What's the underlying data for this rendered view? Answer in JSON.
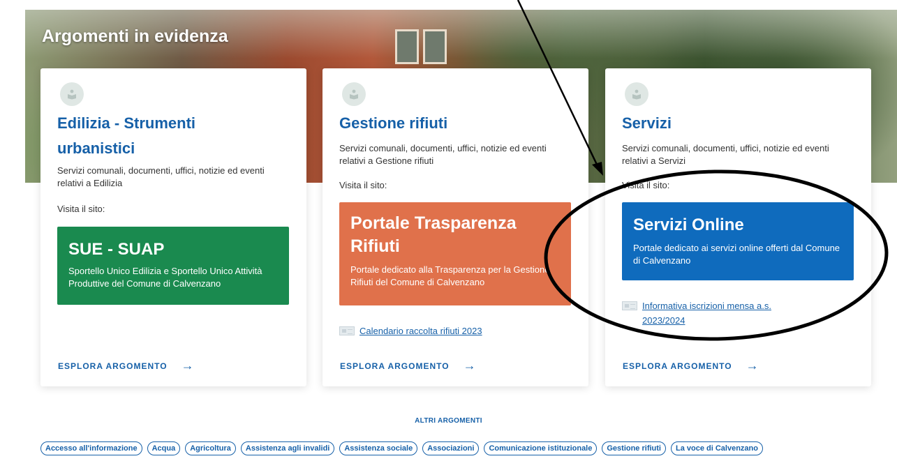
{
  "section": {
    "title": "Argomenti in evidenza"
  },
  "cards": [
    {
      "title_line1": "Edilizia - Strumenti",
      "title_line2": "urbanistici",
      "description": "Servizi comunali, documenti, uffici, notizie ed eventi relativi a Edilizia",
      "visit_label": "Visita il sito:",
      "promo": {
        "title": "SUE - SUAP",
        "text": "Sportello Unico Edilizia e Sportello Unico Attività Produttive del Comune di Calvenzano",
        "color": "#1a8a4f"
      },
      "explore_label": "ESPLORA ARGOMENTO",
      "explore_arrow": "→"
    },
    {
      "title_line1": "Gestione rifiuti",
      "description": "Servizi comunali, documenti, uffici, notizie ed eventi relativi a Gestione rifiuti",
      "visit_label": "Visita il sito:",
      "promo": {
        "title_line1": "Portale Trasparenza",
        "title_line2": "Rifiuti",
        "text": "Portale dedicato alla Trasparenza per la Gestione Rifiuti del Comune di Calvenzano",
        "color": "#e0714b"
      },
      "doc_link": "Calendario raccolta rifiuti 2023",
      "explore_label": "ESPLORA ARGOMENTO",
      "explore_arrow": "→"
    },
    {
      "title_line1": "Servizi",
      "description": "Servizi comunali, documenti, uffici, notizie ed eventi relativi a Servizi",
      "visit_label": "Visita il sito:",
      "promo": {
        "title": "Servizi Online",
        "text": "Portale dedicato ai servizi online offerti dal Comune di Calvenzano",
        "color": "#0f6bbd"
      },
      "doc_link_line1": "Informativa iscrizioni mensa a.s.",
      "doc_link_line2": "2023/2024",
      "explore_label": "ESPLORA ARGOMENTO",
      "explore_arrow": "→"
    }
  ],
  "other_topics": {
    "heading": "ALTRI ARGOMENTI",
    "tags": [
      "Accesso all'informazione",
      "Acqua",
      "Agricoltura",
      "Assistenza agli invalidi",
      "Assistenza sociale",
      "Associazioni",
      "Comunicazione istituzionale",
      "Gestione rifiuti",
      "La voce di Calvenzano"
    ]
  },
  "colors": {
    "accent": "#1660a8",
    "annotation": "#000000"
  },
  "icons": {
    "topic_icon": "book-reader-icon",
    "document_icon": "newspaper-icon",
    "explore_icon": "arrow-right-icon"
  }
}
